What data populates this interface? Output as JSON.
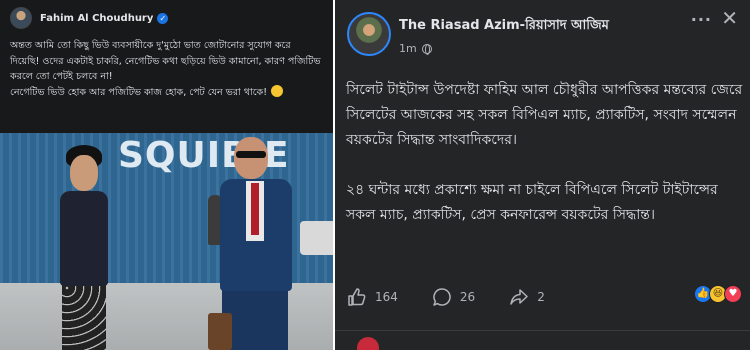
{
  "left_post": {
    "author": "Fahim Al Choudhury",
    "text_lines": [
      "অন্তত আমি তো কিছু ভিউ ব্যবসায়ীকে দু'মুঠো ভাত জোটানোর সুযোগ করে দিয়েছি! ওদের একটাই চাকরি, নেগেটিভ কথা ছড়িয়ে ভিউ কামানো, কারণ পজিটিভ করলে তো পেটই চলবে না!",
      "নেগেটিভ ভিউ হোক আর পজিটিভ কাজ হোক, পেট যেন ভরা থাকে!"
    ],
    "photo_sign": "SQUIBIE"
  },
  "right_post": {
    "author": "The Riasad Azim-রিয়াসাদ আজিম",
    "time": "1m",
    "paragraphs": [
      "সিলেট টাইটান্স উপদেষ্টা ফাহিম আল চৌধুরীর আপত্তিকর মন্তব্যের জেরে সিলেটের আজকের সহ সকল বিপিএল ম্যাচ, প্র্যাকটিস, সংবাদ সম্মেলন বয়কটের সিদ্ধান্ত সাংবাদিকদের।",
      "২৪ ঘন্টার মধ্যে প্রকাশ্যে ক্ষমা না চাইলে বিপিএলে সিলেট টাইটান্সের সকল ম্যাচ, প্র্যাকটিস, প্রেস কনফারেন্স বয়কটের সিদ্ধান্ত।"
    ],
    "likes": "164",
    "comments": "26",
    "shares": "2"
  },
  "colors": {
    "left_bg": "#18191a",
    "right_bg": "#242526",
    "text": "#e4e6eb",
    "muted": "#b0b3b8",
    "accent": "#1877f2"
  }
}
